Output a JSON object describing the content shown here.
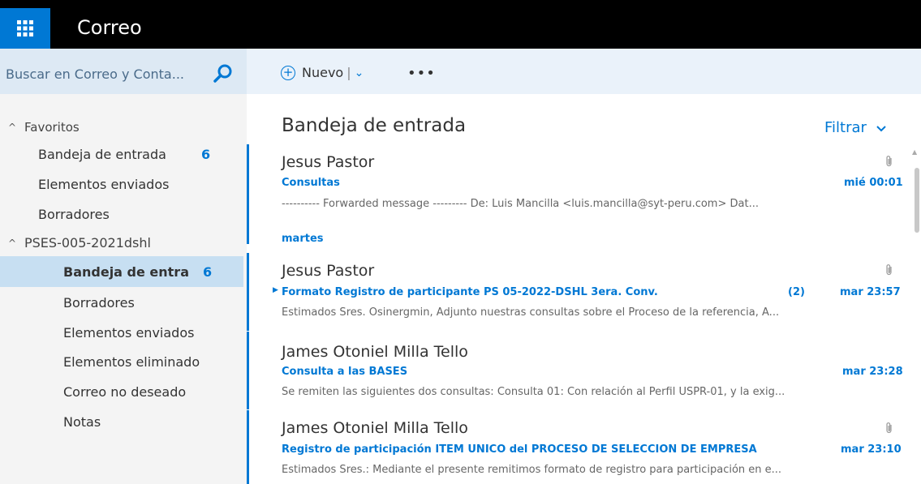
{
  "app": {
    "title": "Correo"
  },
  "search": {
    "placeholder": "Buscar en Correo y Conta..."
  },
  "toolbar": {
    "new_label": "Nuevo",
    "separator": "|",
    "more": "•••"
  },
  "nav": {
    "favorites_header": "Favoritos",
    "favorites": [
      {
        "label": "Bandeja de entrada",
        "count": "6"
      },
      {
        "label": "Elementos enviados"
      },
      {
        "label": "Borradores"
      }
    ],
    "account_header": "PSES-005-2021dshl",
    "folders": [
      {
        "label": "Bandeja de entra",
        "count": "6",
        "selected": true
      },
      {
        "label": "Borradores"
      },
      {
        "label": "Elementos enviados"
      },
      {
        "label": "Elementos eliminado"
      },
      {
        "label": "Correo no deseado"
      },
      {
        "label": "Notas"
      }
    ]
  },
  "list": {
    "title": "Bandeja de entrada",
    "filter_label": "Filtrar",
    "group_label": "martes",
    "messages": [
      {
        "sender": "Jesus Pastor",
        "subject": "Consultas",
        "time": "mié 00:01",
        "preview": "---------- Forwarded message --------- De: Luis Mancilla <luis.mancilla@syt-peru.com> Dat...",
        "attachment": true
      },
      {
        "sender": "Jesus Pastor",
        "subject": "Formato Registro de participante PS 05-2022-DSHL 3era. Conv.",
        "count": "(2)",
        "time": "mar 23:57",
        "preview": "Estimados Sres. Osinergmin, Adjunto nuestras consultas sobre el Proceso de la referencia, A...",
        "attachment": true
      },
      {
        "sender": "James Otoniel Milla Tello",
        "subject": "Consulta a las BASES",
        "time": "mar 23:28",
        "preview": "Se remiten las siguientes dos consultas: Consulta 01: Con relación al Perfil USPR-01, y la exig...",
        "attachment": false
      },
      {
        "sender": "James Otoniel Milla Tello",
        "subject": "Registro de participación ITEM ÚNICO del PROCESO DE SELECCIÓN DE EMPRESA",
        "time": "mar 23:10",
        "preview": "Estimados Sres.: Mediante el presente remitimos formato de registro para participación en e...",
        "attachment": true
      }
    ]
  },
  "colors": {
    "accent": "#0078d4",
    "topbar": "#000000",
    "selected": "#c7dff2"
  }
}
